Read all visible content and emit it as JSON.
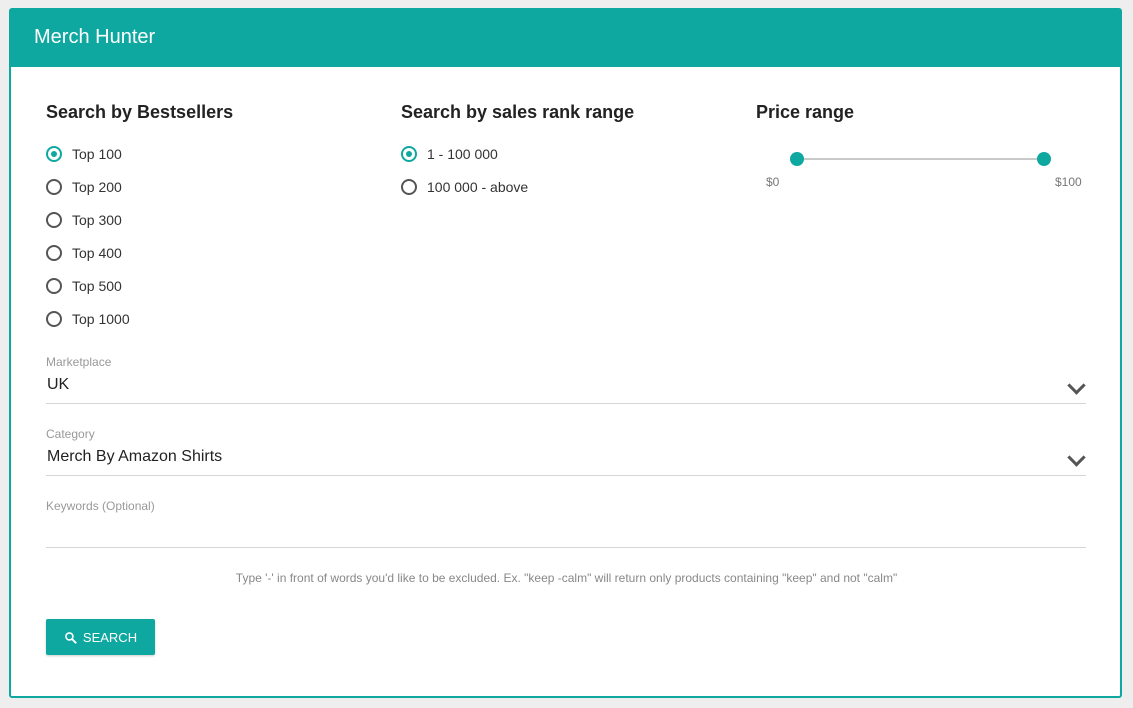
{
  "header": {
    "title": "Merch Hunter"
  },
  "colors": {
    "accent": "#0ea8a0"
  },
  "bestsellers": {
    "title": "Search by Bestsellers",
    "options": [
      "Top 100",
      "Top 200",
      "Top 300",
      "Top 400",
      "Top 500",
      "Top 1000"
    ],
    "selected": "Top 100"
  },
  "sales_rank": {
    "title": "Search by sales rank range",
    "options": [
      "1 - 100 000",
      "100 000 - above"
    ],
    "selected": "1 - 100 000"
  },
  "price_range": {
    "title": "Price range",
    "min_label": "$0",
    "max_label": "$100",
    "min_value": 0,
    "max_value": 100
  },
  "marketplace": {
    "label": "Marketplace",
    "value": "UK"
  },
  "category": {
    "label": "Category",
    "value": "Merch By Amazon Shirts"
  },
  "keywords": {
    "label": "Keywords (Optional)",
    "value": ""
  },
  "hint": "Type '-' in front of words you'd like to be excluded. Ex. \"keep -calm\" will return only products containing \"keep\" and not \"calm\"",
  "search_button": {
    "label": "SEARCH",
    "icon": "search-icon"
  }
}
